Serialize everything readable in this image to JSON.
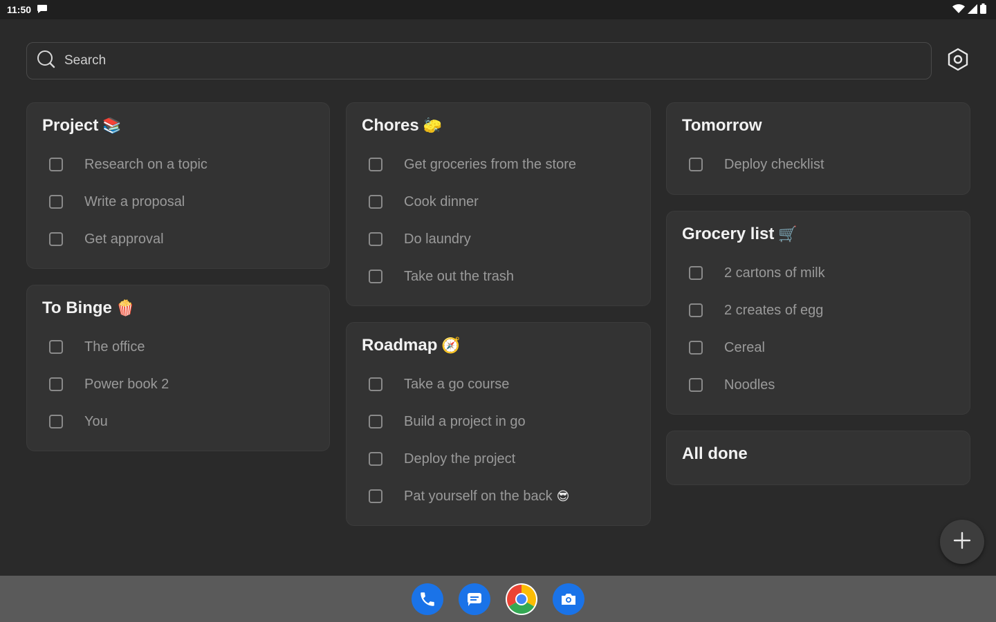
{
  "status_bar": {
    "time": "11:50",
    "left_icons": [
      "chat-notification-icon"
    ],
    "right_icons": [
      "wifi-icon",
      "cell-signal-icon",
      "battery-icon"
    ]
  },
  "search": {
    "placeholder": "Search"
  },
  "colors": {
    "background": "#2a2a2a",
    "card": "#333333",
    "text_primary": "#f2f2f2",
    "text_secondary": "#9a9a9a",
    "dock": "#5a5a5a",
    "accent_blue": "#1a73e8"
  },
  "lists": {
    "project": {
      "title": "Project",
      "emoji": "📚",
      "items": [
        "Research on a topic",
        "Write a proposal",
        "Get approval"
      ]
    },
    "to_binge": {
      "title": "To Binge",
      "emoji": "🍿",
      "items": [
        "The office",
        "Power book 2",
        "You"
      ]
    },
    "chores": {
      "title": "Chores",
      "emoji": "🧽",
      "items": [
        "Get groceries from the store",
        "Cook dinner",
        "Do laundry",
        "Take out the trash"
      ]
    },
    "roadmap": {
      "title": "Roadmap",
      "emoji": "🧭",
      "items": [
        "Take a go course",
        "Build a project in go",
        "Deploy the project",
        "Pat yourself on the back"
      ],
      "last_item_emoji": "😎"
    },
    "tomorrow": {
      "title": "Tomorrow",
      "items": [
        "Deploy checklist"
      ]
    },
    "grocery": {
      "title": "Grocery list",
      "emoji": "🛒",
      "items": [
        "2 cartons of milk",
        "2 creates of egg",
        "Cereal",
        "Noodles"
      ]
    },
    "all_done": {
      "title": "All done"
    }
  },
  "fab": {
    "icon": "plus-icon"
  },
  "dock": {
    "apps": [
      "phone-app-icon",
      "messages-app-icon",
      "chrome-app-icon",
      "camera-app-icon"
    ]
  }
}
